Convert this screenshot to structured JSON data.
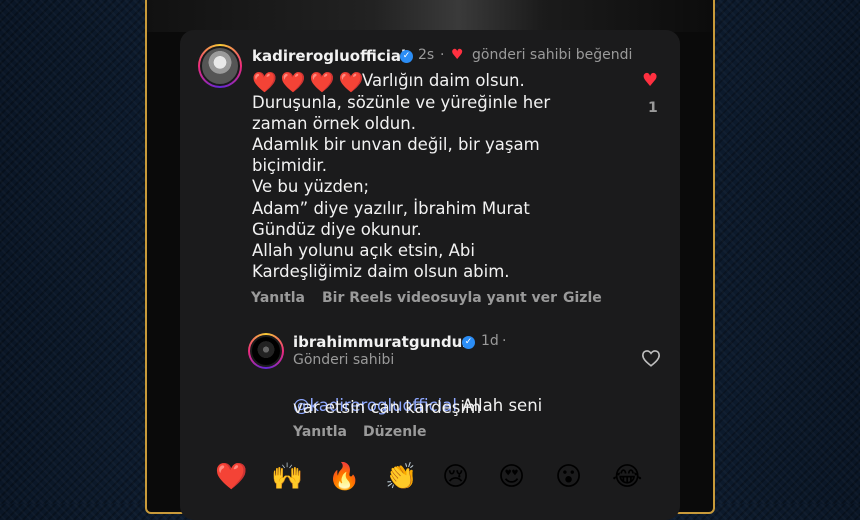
{
  "comment": {
    "username": "kadirerogluofficial",
    "time": "2s",
    "dot": "·",
    "owner_liked": "gönderi sahibi beğendi",
    "hearts": [
      "❤️",
      "❤️",
      "❤️",
      "❤️"
    ],
    "first_line": "Varlığın daim olsun.",
    "lines": [
      "Duruşunla, sözünle ve yüreğinle her",
      "zaman örnek oldun.",
      "Adamlık bir unvan değil, bir yaşam",
      "biçimidir.",
      "Ve bu yüzden;",
      "Adam” diye yazılır, İbrahim Murat",
      "Gündüz diye okunur.",
      "Allah yolunu açık etsin, Abi",
      "Kardeşliğimiz daim olsun abim."
    ],
    "like_count": "1",
    "actions": {
      "reply": "Yanıtla",
      "reels_reply": "Bir Reels videosuyla yanıt ver",
      "hide": "Gizle"
    }
  },
  "reply": {
    "username": "ibrahimmuratgunduz",
    "time": "1d",
    "dot": "·",
    "owner_label": "Gönderi sahibi",
    "mention": "@kadirerogluofficial",
    "text_after_mention": " Allah seni",
    "line2": "var etsin can kardeşim",
    "actions": {
      "reply": "Yanıtla",
      "edit": "Düzenle"
    }
  },
  "emoji_bar": [
    "❤️",
    "🙌",
    "🔥",
    "👏",
    "😢",
    "😍",
    "😮",
    "😂"
  ],
  "colors": {
    "like_red": "#ff3040",
    "mention_blue": "#8ea8ff",
    "frame_gold": "#c89a3a"
  }
}
